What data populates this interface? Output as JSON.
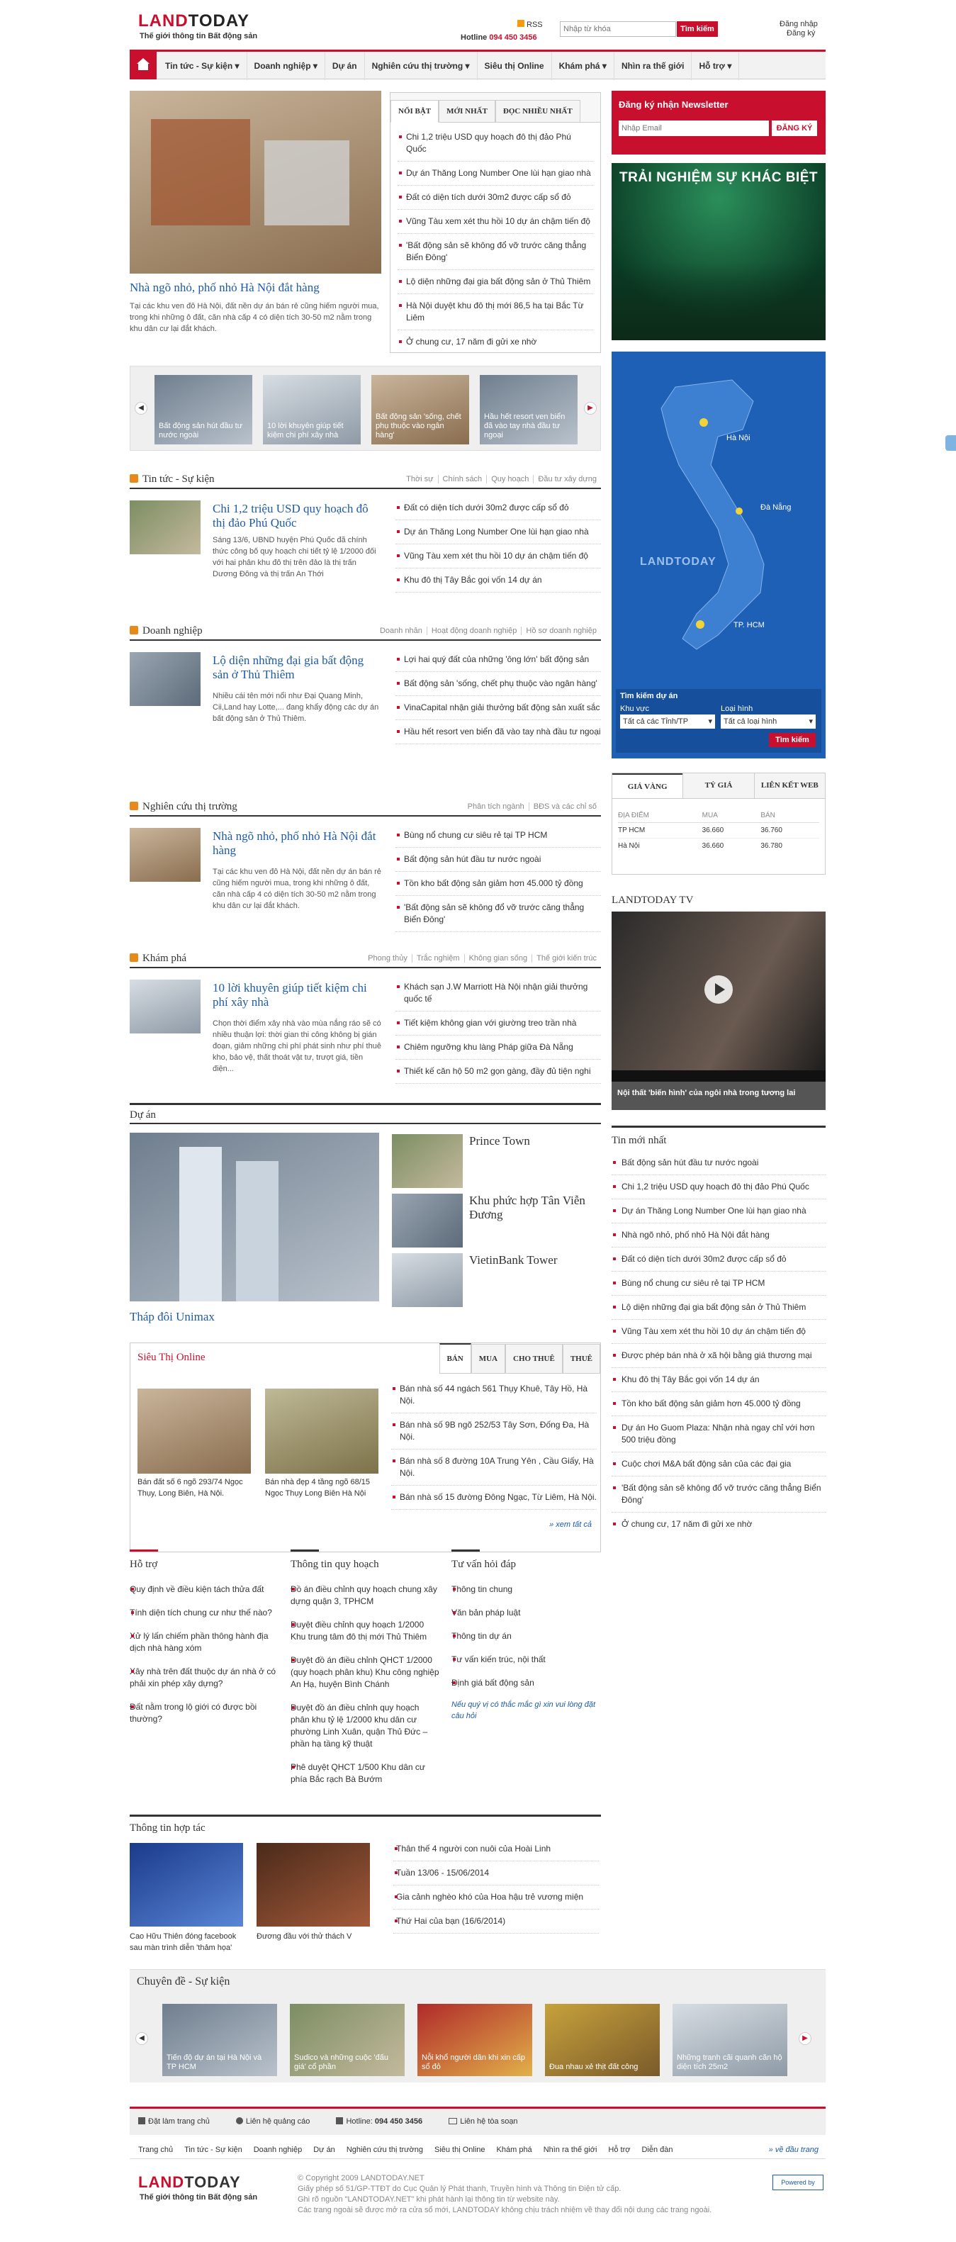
{
  "header": {
    "logo_a": "LAND",
    "logo_b": "TODAY",
    "tagline": "Thế giới thông tin Bất động sản",
    "rss": "RSS",
    "hotline_label": "Hotline",
    "hotline": "094 450 3456",
    "search_placeholder": "Nhập từ khóa",
    "search_btn": "Tìm kiếm",
    "login": "Đăng nhập",
    "register": "Đăng ký"
  },
  "nav": [
    "Tin tức - Sự kiện",
    "Doanh nghiệp",
    "Dự án",
    "Nghiên cứu thị trường",
    "Siêu thị Online",
    "Khám phá",
    "Nhìn ra thế giới",
    "Hỗ trợ"
  ],
  "feature": {
    "title": "Nhà ngõ nhỏ, phố nhỏ Hà Nội đắt hàng",
    "desc": "Tại các khu ven đô Hà Nội, đất nền dự án bán rẻ cũng hiếm người mua, trong khi những ô đất, căn nhà cấp 4 có diện tích 30-50 m2 nằm trong khu dân cư lại đắt khách."
  },
  "tabs": [
    "Nổi bật",
    "Mới nhất",
    "Đọc nhiều nhất"
  ],
  "hot_list": [
    "Chi 1,2 triệu USD quy hoạch đô thị đảo Phú Quốc",
    "Dự án Thăng Long Number One lùi hạn giao nhà",
    "Đất có diện tích dưới 30m2 được cấp sổ đỏ",
    "Vũng Tàu xem xét thu hồi 10 dự án chậm tiến độ",
    "'Bất động sản sẽ không đổ vỡ trước căng thẳng Biển Đông'",
    "Lộ diện những đại gia bất động sản ở Thủ Thiêm",
    "Hà Nội duyệt khu đô thị mới 86,5 ha tại Bắc Từ Liêm",
    "Ở chung cư, 17 năm đi gửi xe nhờ"
  ],
  "carousel": [
    "Bất động sản hút đầu tư nước ngoài",
    "10 lời khuyên giúp tiết kiệm chi phí xây nhà",
    "Bất động sản 'sống, chết phụ thuộc vào ngân hàng'",
    "Hầu hết resort ven biển đã vào tay nhà đầu tư ngoại"
  ],
  "sec_news": {
    "title": "Tin tức - Sự kiện",
    "links": [
      "Thời sự",
      "Chính sách",
      "Quy hoạch",
      "Đầu tư xây dựng"
    ],
    "lead": "Chi 1,2 triệu USD quy hoạch đô thị đảo Phú Quốc",
    "desc": "Sáng 13/6, UBND huyện Phú Quốc đã chính thức công bố quy hoạch chi tiết tỷ lệ 1/2000 đối với hai phân khu đô thị trên đảo là thị trấn Dương Đông và thị trấn An Thới",
    "list": [
      "Đất có diện tích dưới 30m2 được cấp sổ đỏ",
      "Dự án Thăng Long Number One lùi hạn giao nhà",
      "Vũng Tàu xem xét thu hồi 10 dự án chậm tiến độ",
      "Khu đô thị Tây Bắc gọi vốn 14 dự án"
    ]
  },
  "sec_biz": {
    "title": "Doanh nghiệp",
    "links": [
      "Doanh nhân",
      "Hoạt động doanh nghiệp",
      "Hồ sơ doanh nghiệp"
    ],
    "lead": "Lộ diện những đại gia bất động sản ở Thủ Thiêm",
    "desc": "Nhiều cái tên mới nổi như Đại Quang Minh, Cii,Land hay Lotte,... đang khẩy động các dự án bất động sản ở Thủ Thiêm.",
    "list": [
      "Lợi hai quý đất của những 'ông lớn' bất động sản",
      "Bất động sản 'sống, chết phụ thuộc vào ngân hàng'",
      "VinaCapital nhận giải thưởng bất động sản xuất sắc",
      "Hầu hết resort ven biển đã vào tay nhà đầu tư ngoại"
    ]
  },
  "sec_market": {
    "title": "Nghiên cứu thị trường",
    "links": [
      "Phân tích ngành",
      "BĐS và các chỉ số"
    ],
    "lead": "Nhà ngõ nhỏ, phố nhỏ Hà Nội đắt hàng",
    "desc": "Tại các khu ven đô Hà Nội, đất nền dự án bán rẻ cũng hiếm người mua, trong khi những ô đất, căn nhà cấp 4 có diện tích 30-50 m2 nằm trong khu dân cư lại đắt khách.",
    "list": [
      "Bùng nổ chung cư siêu rẻ tại TP HCM",
      "Bất động sản hút đầu tư nước ngoài",
      "Tồn kho bất động sản giảm hơn 45.000 tỷ đồng",
      "'Bất động sản sẽ không đổ vỡ trước căng thẳng Biển Đông'"
    ]
  },
  "sec_explore": {
    "title": "Khám phá",
    "links": [
      "Phong thủy",
      "Trắc nghiệm",
      "Không gian sống",
      "Thế giới kiến trúc"
    ],
    "lead": "10 lời khuyên giúp tiết kiệm chi phí xây nhà",
    "desc": "Chọn thời điểm xây nhà vào mùa nắng ráo sẽ có nhiều thuận lợi: thời gian thi công không bị gián đoạn, giảm những chi phí phát sinh như phí thuê kho, bảo vệ, thất thoát vật tư, trượt giá, tiền điện...",
    "list": [
      "Khách sạn J.W Marriott Hà Nội nhận giải thưởng quốc tế",
      "Tiết kiệm không gian với giường treo trần nhà",
      "Chiêm ngưỡng khu làng Pháp giữa Đà Nẵng",
      "Thiết kế căn hộ 50 m2 gọn gàng, đầy đủ tiện nghi"
    ]
  },
  "projects": {
    "title": "Dự án",
    "main": "Tháp đôi Unimax",
    "items": [
      "Prince Town",
      "Khu phức hợp Tân Viễn Đương",
      "VietinBank Tower"
    ]
  },
  "market": {
    "title": "Siêu Thị Online",
    "tabs": [
      "Bán",
      "Mua",
      "Cho thuê",
      "Thuê"
    ],
    "items": [
      "Bán đất số 6 ngõ 293/74 Ngọc Thụy, Long Biên, Hà Nội.",
      "Bán nhà đẹp 4 tầng ngõ 68/15 Ngọc Thụy Long Biên Hà Nội"
    ],
    "list": [
      "Bán nhà số 44 ngách 561 Thụy Khuê, Tây Hồ, Hà Nội.",
      "Bán nhà số 9B ngõ 252/53 Tây Sơn, Đống Đa, Hà Nội.",
      "Bán nhà số 8 đường 10A Trung Yên , Cầu Giấy, Hà Nội.",
      "Bán nhà số 15 đường Đông Ngạc, Từ Liêm, Hà Nội."
    ],
    "more": "» xem tất cả"
  },
  "support": {
    "title": "Hỗ trợ",
    "items": [
      "Quy định về điều kiện tách thửa đất",
      "Tính diện tích chung cư như thế nào?",
      "Xử lý lấn chiếm phần thông hành địa dịch nhà hàng xóm",
      "Xây nhà trên đất thuộc dự án nhà ở có phải xin phép xây dựng?",
      "Đất nằm trong lộ giới có được bồi thường?"
    ]
  },
  "planning": {
    "title": "Thông tin quy hoạch",
    "items": [
      "Đồ án điều chỉnh quy hoạch chung xây dựng quận 3, TPHCM",
      "Duyệt điều chỉnh quy hoạch 1/2000 Khu trung tâm đô thị mới Thủ Thiêm",
      "Duyệt đồ án điều chỉnh QHCT 1/2000 (quy hoạch phân khu) Khu công nghiệp An Hạ, huyện Bình Chánh",
      "Duyệt đồ án điều chỉnh quy hoạch phân khu tỷ lệ 1/2000 khu dân cư phường Linh Xuân, quận Thủ Đức – phần hạ tầng kỹ thuật",
      "Phê duyệt QHCT 1/500 Khu dân cư phía Bắc rạch Bà Bướm"
    ]
  },
  "advice": {
    "title": "Tư vấn hỏi đáp",
    "items": [
      "Thông tin chung",
      "Văn bản pháp luật",
      "Thông tin dự án",
      "Tư vấn kiến trúc, nội thất",
      "Định giá bất động sản"
    ],
    "note": "Nếu quý vị có thắc mắc gì xin vui lòng đặt câu hỏi"
  },
  "partners": {
    "title": "Thông tin hợp tác",
    "items": [
      "Cao Hữu Thiên đóng facebook sau màn trình diễn 'thảm họa'",
      "Đương đầu với thử thách V"
    ],
    "list": [
      "Thân thế 4 người con nuôi của Hoài Linh",
      "Tuần 13/06 - 15/06/2014",
      "Gia cảnh nghèo khó của Hoa hậu trẻ vương miện",
      "Thứ Hai của bạn (16/6/2014)"
    ]
  },
  "topics": {
    "title": "Chuyên đề - Sự kiện",
    "items": [
      "Tiến độ dự án tại Hà Nội và TP HCM",
      "Sudico và những cuộc 'đấu giá' cổ phần",
      "Nỗi khổ người dân khi xin cấp sổ đỏ",
      "Đua nhau xẻ thịt đất công",
      "Những tranh cãi quanh căn hộ diện tích 25m2"
    ]
  },
  "newsletter": {
    "title": "Đăng ký nhận Newsletter",
    "placeholder": "Nhập Email",
    "btn": "Đăng ký"
  },
  "ad": {
    "text": "TRẢI NGHIỆM SỰ KHÁC BIỆT"
  },
  "map": {
    "cities": [
      "Hà Nội",
      "Đà Nẵng",
      "TP. HCM"
    ],
    "brand": "LANDTODAY",
    "search_title": "Tìm kiếm dự án",
    "area_label": "Khu vực",
    "type_label": "Loại hình",
    "area": "Tất cả các Tỉnh/TP",
    "type": "Tất cả loại hình",
    "btn": "Tìm kiếm"
  },
  "gold": {
    "tabs": [
      "Giá vàng",
      "Tỷ giá",
      "Liên kết web"
    ],
    "headers": [
      "Địa điểm",
      "Mua",
      "Bán"
    ],
    "rows": [
      [
        "TP HCM",
        "36.660",
        "36.760"
      ],
      [
        "Hà Nội",
        "36.660",
        "36.780"
      ]
    ]
  },
  "tv": {
    "title": "LANDTODAY TV",
    "caption": "Nội thất 'biến hình' của ngôi nhà trong tương lai"
  },
  "latest": {
    "title": "Tin mới nhất",
    "items": [
      "Bất động sản hút đầu tư nước ngoài",
      "Chi 1,2 triệu USD quy hoạch đô thị đảo Phú Quốc",
      "Dự án Thăng Long Number One lùi hạn giao nhà",
      "Nhà ngõ nhỏ, phố nhỏ Hà Nội đắt hàng",
      "Đất có diện tích dưới 30m2 được cấp sổ đỏ",
      "Bùng nổ chung cư siêu rẻ tại TP HCM",
      "Lộ diện những đại gia bất động sản ở Thủ Thiêm",
      "Vũng Tàu xem xét thu hồi 10 dự án chậm tiến độ",
      "Được phép bán nhà ở xã hội bằng giá thương mại",
      "Khu đô thị Tây Bắc gọi vốn 14 dự án",
      "Tồn kho bất động sản giảm hơn 45.000 tỷ đồng",
      "Dự án Ho Guom Plaza: Nhận nhà ngay chỉ với hơn 500 triệu đồng",
      "Cuộc chơi M&A bất động sản của các đại gia",
      "'Bất động sản sẽ không đổ vỡ trước căng thẳng Biển Đông'",
      "Ở chung cư, 17 năm đi gửi xe nhờ"
    ]
  },
  "footer": {
    "contacts": [
      "Đặt làm trang chủ",
      "Liên hệ quảng cáo",
      "Hotline:",
      "094 450 3456",
      "Liên hệ tòa soạn"
    ],
    "nav": [
      "Trang chủ",
      "Tin tức - Sự kiện",
      "Doanh nghiệp",
      "Dự án",
      "Nghiên cứu thị trường",
      "Siêu thị Online",
      "Khám phá",
      "Nhìn ra thế giới",
      "Hỗ trợ",
      "Diễn đàn"
    ],
    "top": "» về đầu trang",
    "copy": "© Copyright 2009 LANDTODAY.NET",
    "license": "Giấy phép số 51/GP-TTĐT do Cục Quản lý Phát thanh, Truyền hình và Thông tin Điện tử cấp.",
    "source": "Ghi rõ nguồn \"LANDTODAY.NET\" khi phát hành lại thông tin từ website này.",
    "disclaimer": "Các trang ngoài sẽ được mở ra cửa sổ mới, LANDTODAY không chịu trách nhiệm về thay đổi nội dung các trang ngoài.",
    "powered": "Powered by"
  }
}
